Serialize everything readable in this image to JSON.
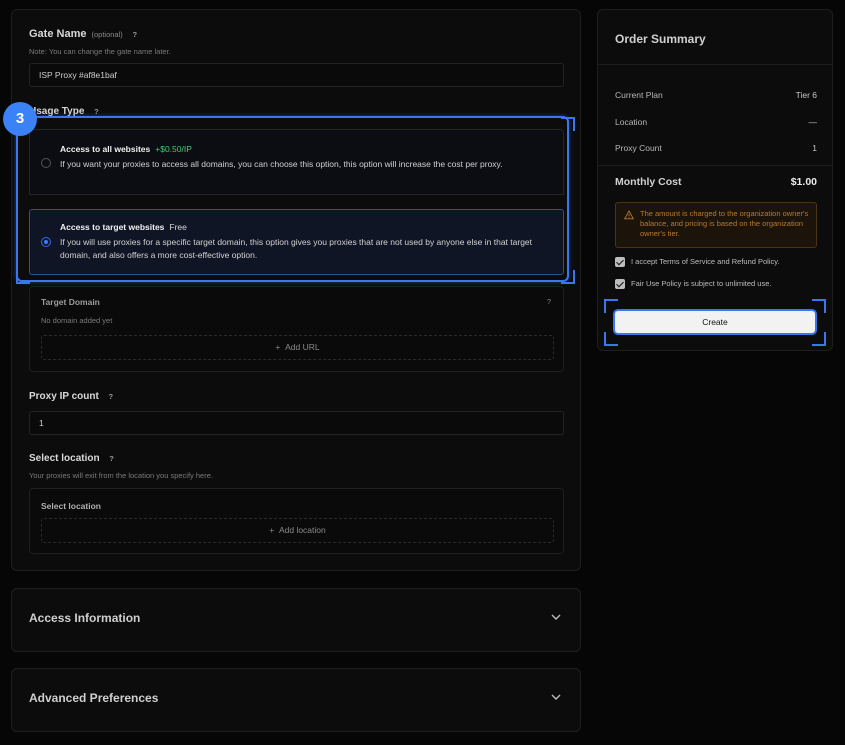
{
  "form": {
    "gate_name": {
      "label": "Gate Name",
      "optional": "(optional)",
      "help": "?",
      "note": "Note: You can change the gate name later.",
      "value": "ISP Proxy #af8e1baf"
    },
    "usage_type": {
      "label": "Usage Type",
      "help": "?",
      "step": "3",
      "options": [
        {
          "title": "Access to all websites",
          "price": "+$0.50/IP",
          "description": "If you want your proxies to access all domains, you can choose this option, this option will increase the cost per proxy.",
          "selected": false
        },
        {
          "title": "Access to target websites",
          "price": "Free",
          "description": "If you will use proxies for a specific target domain, this option gives you proxies that are not used by anyone else in that target domain, and also offers a more cost-effective option.",
          "selected": true
        }
      ]
    },
    "target_domain": {
      "label": "Target Domain",
      "help": "?",
      "empty": "No domain added yet",
      "add_label": "Add URL"
    },
    "proxy_ip_count": {
      "label": "Proxy IP count",
      "help": "?",
      "value": "1"
    },
    "select_location": {
      "label": "Select location",
      "help": "?",
      "note": "Your proxies will exit from the location you specify here.",
      "inner_label": "Select location",
      "add_label": "Add location"
    }
  },
  "accordions": [
    {
      "title": "Access Information"
    },
    {
      "title": "Advanced Preferences"
    }
  ],
  "summary": {
    "title": "Order Summary",
    "rows": [
      {
        "label": "Current Plan",
        "value": "Tier 6"
      },
      {
        "label": "Location",
        "value": "—"
      },
      {
        "label": "Proxy Count",
        "value": "1"
      }
    ],
    "monthly_cost": {
      "label": "Monthly Cost",
      "value": "$1.00"
    },
    "warning": "The amount is charged to the organization owner's balance, and pricing is based on the organization owner's tier.",
    "checkboxes": [
      {
        "label": "I accept Terms of Service and Refund Policy.",
        "checked": true
      },
      {
        "label": "Fair Use Policy is subject to unlimited use.",
        "checked": true
      }
    ],
    "create_label": "Create"
  },
  "colors": {
    "accent": "#3b76f0",
    "price_green": "#3ecf6f",
    "warning": "#b77a2c"
  },
  "icons": {
    "add": "plus-icon",
    "accordion": "chevron-down-icon",
    "warning": "warning-triangle-icon",
    "help": "question-icon"
  }
}
